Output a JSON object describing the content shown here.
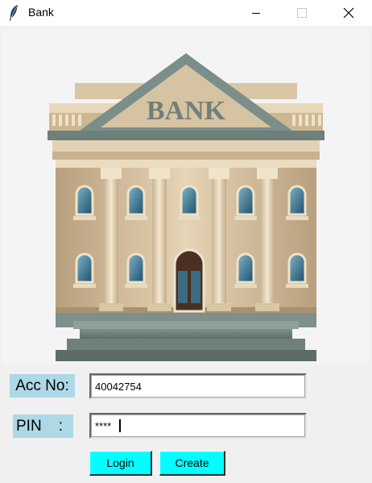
{
  "window": {
    "title": "Bank",
    "controls": {
      "minimize": "minimize-icon",
      "maximize": "maximize-icon",
      "close": "close-icon"
    }
  },
  "banner": {
    "sign_text": "BANK"
  },
  "form": {
    "account": {
      "label": "Acc No:",
      "value": "40042754"
    },
    "pin": {
      "label": "PIN    :",
      "value": "****"
    }
  },
  "buttons": {
    "login": "Login",
    "create": "Create"
  },
  "colors": {
    "label_bg": "#add8e6",
    "button_bg": "#00ffff"
  }
}
